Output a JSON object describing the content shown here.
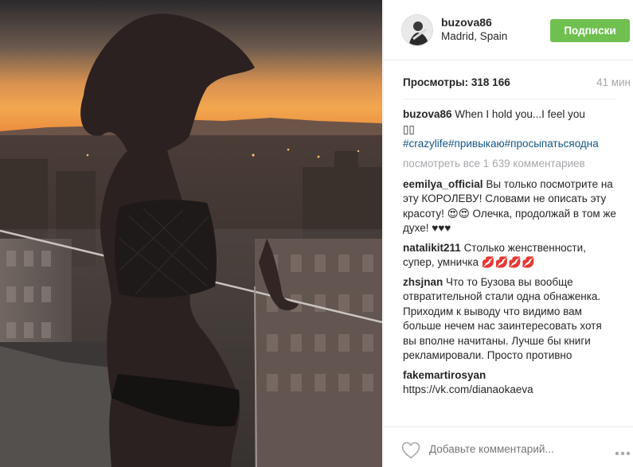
{
  "header": {
    "username": "buzova86",
    "location": "Madrid, Spain",
    "follow_label": "Подписки"
  },
  "stats": {
    "views_label": "Просмотры:",
    "views_count": "318 166",
    "time_ago": "41 мин"
  },
  "caption": {
    "username": "buzova86",
    "text": "When I hold you...I feel you",
    "emoji": "▯▯",
    "tags": [
      "#crazylife",
      "#привыкаю",
      "#проcыпатьсяодна"
    ]
  },
  "view_all_comments": "посмотреть все 1 639 комментариев",
  "comments": [
    {
      "username": "eemilya_official",
      "text": "Вы только посмотрите на эту КОРОЛЕВУ! Словами не описать эту красоту! 😍😍 Олечка, продолжай в том же духе! ♥♥♥"
    },
    {
      "username": "natalikit211",
      "text": "Столько женственности, супер, умничка 💋💋💋💋"
    },
    {
      "username": "zhsjnan",
      "text": "Что то Бузова вы вообще отвратительной стали одна обнаженка. Приходим к выводу что видимо вам больше нечем нас заинтересовать хотя вы вполне начитаны. Лучше бы книги рекламировали. Просто противно"
    },
    {
      "username": "fakemartirosyan",
      "text": "https://vk.com/dianaokaeva"
    }
  ],
  "footer": {
    "add_comment_placeholder": "Добавьте комментарий...",
    "icons": [
      "heart-icon",
      "more-options-icon"
    ]
  },
  "colors": {
    "follow_button": "#70c050",
    "hashtag": "#125688",
    "muted": "#a5a7aa"
  }
}
